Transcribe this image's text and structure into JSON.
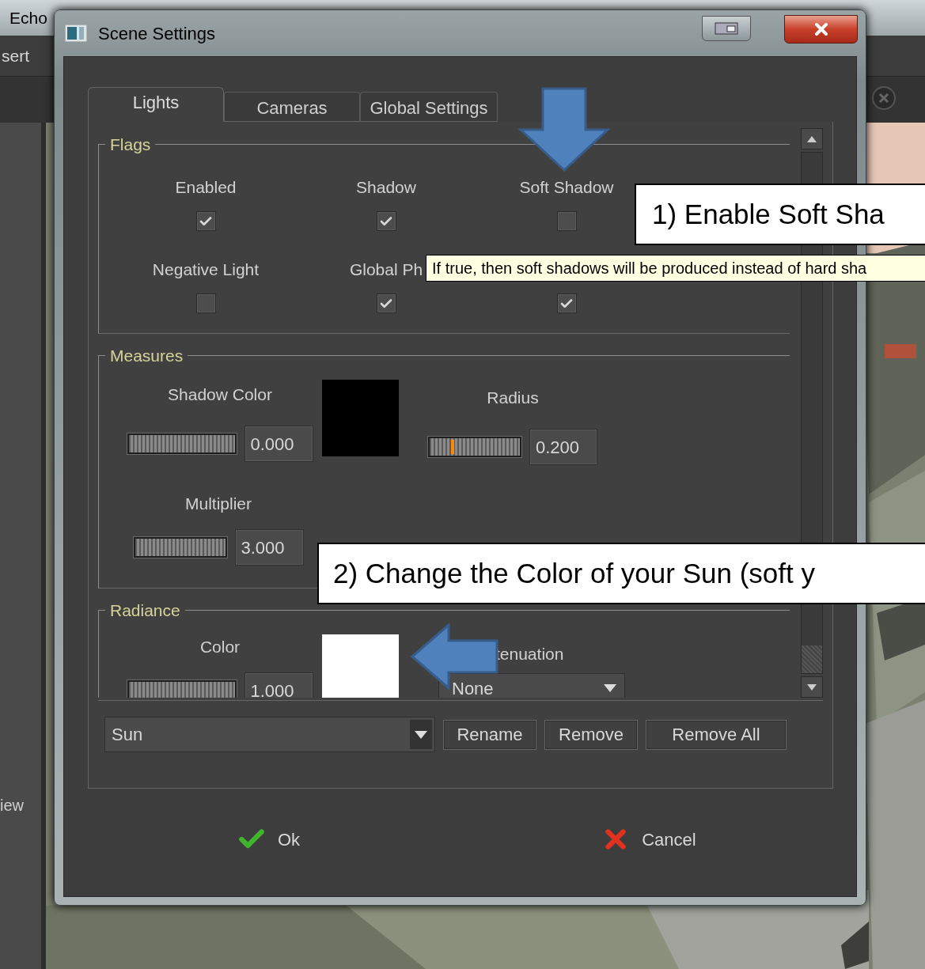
{
  "background_app": {
    "title": "Echo",
    "menu_item": "sert",
    "side_label": "iew"
  },
  "dialog": {
    "title": "Scene Settings"
  },
  "tabs": [
    {
      "label": "Lights",
      "selected": true
    },
    {
      "label": "Cameras",
      "selected": false
    },
    {
      "label": "Global Settings",
      "selected": false
    }
  ],
  "flags": {
    "title": "Flags",
    "items": [
      {
        "label": "Enabled",
        "checked": true
      },
      {
        "label": "Shadow",
        "checked": true
      },
      {
        "label": "Soft Shadow",
        "checked": false
      },
      {
        "label": "Negative Light",
        "checked": false
      },
      {
        "label": "Global Ph",
        "checked": true
      },
      {
        "checked": true
      }
    ]
  },
  "measures": {
    "title": "Measures",
    "shadow_color": {
      "label": "Shadow Color",
      "value": "0.000",
      "color": "#000000"
    },
    "radius": {
      "label": "Radius",
      "value": "0.200",
      "level": 0.25
    },
    "multiplier": {
      "label": "Multiplier",
      "value": "3.000"
    }
  },
  "radiance": {
    "title": "Radiance",
    "color": {
      "label": "Color",
      "value": "1.000",
      "color": "#ffffff"
    },
    "attenuation": {
      "label": "tenuation",
      "value": "None"
    }
  },
  "light_selector": {
    "value": "Sun"
  },
  "buttons": [
    "Rename",
    "Remove",
    "Remove All"
  ],
  "footer": {
    "ok": "Ok",
    "cancel": "Cancel"
  },
  "tooltip": "If true, then soft shadows will be produced instead of hard sha",
  "callouts": [
    "1) Enable Soft Sha",
    "2) Change the Color of your Sun (soft y"
  ]
}
